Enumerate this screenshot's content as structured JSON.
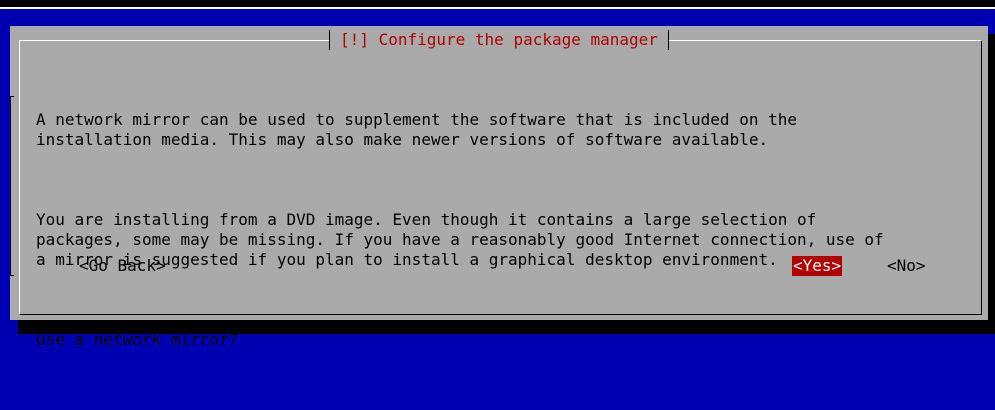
{
  "dialog": {
    "title": "[!] Configure the package manager",
    "paragraphs": [
      "A network mirror can be used to supplement the software that is included on the\ninstallation media. This may also make newer versions of software available.",
      "You are installing from a DVD image. Even though it contains a large selection of\npackages, some may be missing. If you have a reasonably good Internet connection, use of\na mirror is suggested if you plan to install a graphical desktop environment.",
      "Use a network mirror?"
    ],
    "buttons": {
      "go_back": "<Go Back>",
      "yes": "<Yes>",
      "no": "<No>"
    }
  },
  "colors": {
    "background": "#0000b2",
    "dialog": "#aaaaaa",
    "title": "#b20000",
    "selected_button": "#b20000"
  }
}
